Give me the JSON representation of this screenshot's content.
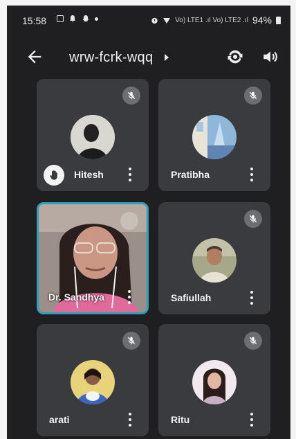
{
  "status_bar": {
    "time": "15:58",
    "network_text": "Vo) LTE1 .ıl Vo) LTE2 .ıl",
    "battery": "94%"
  },
  "meeting": {
    "code": "wrw-fcrk-wqq"
  },
  "participants": [
    {
      "name": "Hitesh",
      "muted": true,
      "hand_raised": true
    },
    {
      "name": "Pratibha",
      "muted": true,
      "hand_raised": false
    },
    {
      "name": "Dr. Sandhya",
      "muted": true,
      "video_on": true,
      "active_speaker": true
    },
    {
      "name": "Safiullah",
      "muted": true,
      "hand_raised": false
    },
    {
      "name": "arati",
      "muted": true,
      "hand_raised": false
    },
    {
      "name": "Ritu",
      "muted": true,
      "hand_raised": false
    }
  ],
  "colors": {
    "background": "#1f1f21",
    "tile": "#3a3b3e",
    "active_border": "#2f9fb7",
    "text": "#f2f2f2"
  }
}
